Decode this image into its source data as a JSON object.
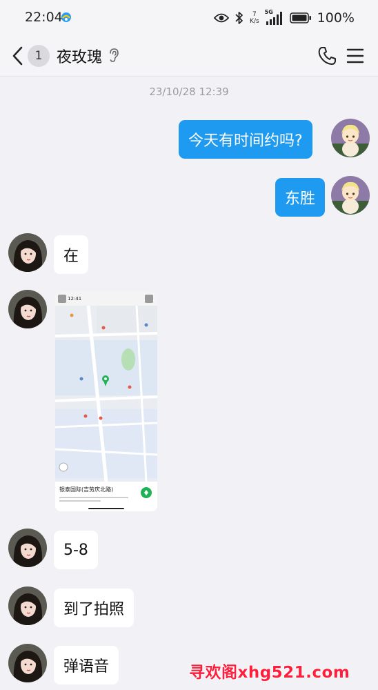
{
  "status_bar": {
    "time": "22:04",
    "net_speed_value": "7",
    "net_speed_unit": "K/s",
    "network_type": "5G",
    "battery": "100%",
    "icons": [
      "eye-icon",
      "bluetooth-icon",
      "signal-icon",
      "battery-icon"
    ]
  },
  "header": {
    "unread_count": "1",
    "contact_name": "夜玫瑰",
    "icons": [
      "back-chevron-icon",
      "ear-icon",
      "phone-icon",
      "menu-icon"
    ]
  },
  "conversation": {
    "timestamp": "23/10/28 12:39",
    "messages": [
      {
        "sender": "me",
        "type": "text",
        "text": "今天有时间约吗?"
      },
      {
        "sender": "me",
        "type": "text",
        "text": "东胜"
      },
      {
        "sender": "contact",
        "type": "text",
        "text": "在"
      },
      {
        "sender": "contact",
        "type": "image",
        "description": "location-map-screenshot"
      },
      {
        "sender": "contact",
        "type": "text",
        "text": "5-8"
      },
      {
        "sender": "contact",
        "type": "text",
        "text": "到了拍照"
      },
      {
        "sender": "contact",
        "type": "text",
        "text": "弹语音"
      }
    ]
  },
  "map_card": {
    "time": "12:41",
    "place_name": "银泰国际(吉劳庆北路)"
  },
  "watermark": "寻欢阁xhg521.com",
  "colors": {
    "outgoing_bubble": "#1e9bf0",
    "incoming_bubble": "#ffffff",
    "background": "#f2f2f6",
    "watermark": "#ff1f3d"
  }
}
